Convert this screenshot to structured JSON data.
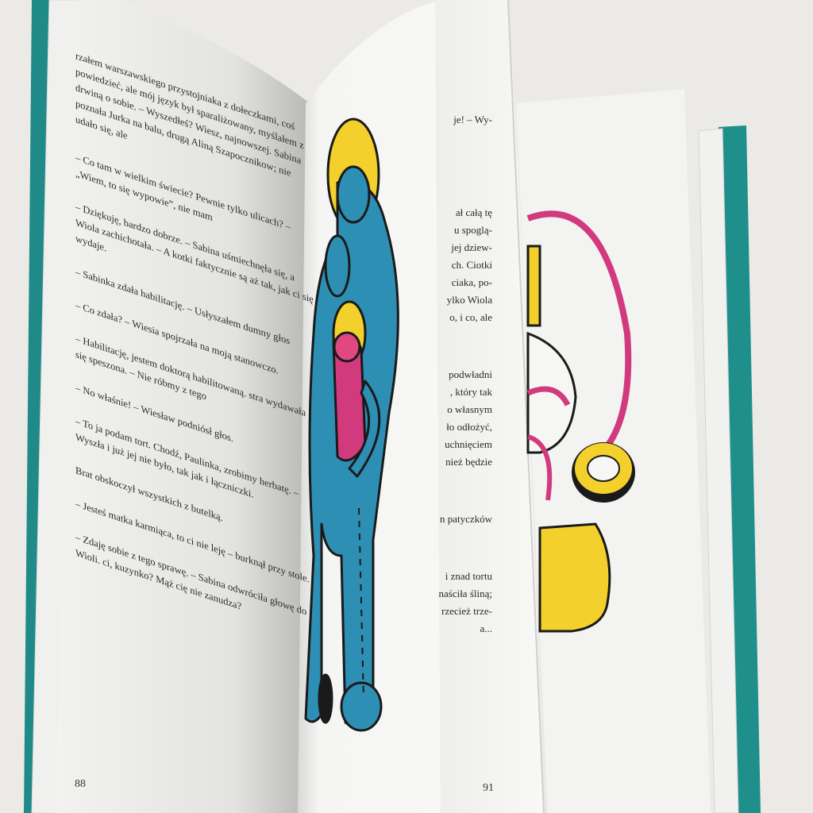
{
  "photo": {
    "description_tags": [
      "open-book",
      "illustration",
      "polish-text"
    ]
  },
  "left_page": {
    "page_number": "88",
    "paragraphs": [
      "rzałem warszawskiego przystojniaka z dołeczkami, coś powiedzieć, ale mój język był sparaliżowany, myślałem z drwiną o sobie. – Wyszedłeś? Wiesz, najnowszej. Sabina poznała Jurka na balu, drugą Aliną Szapocznikow; nie udało się, ale",
      "– Co tam w wielkim świecie? Pewnie tylko ulicach? – „Wiem, to się wypowie”, nie mam",
      "– Dziękuję, bardzo dobrze. – Sabina uśmiechnęła się, a Wiola zachichotała. – A kotki faktycznie są aż tak, jak ci się wydaje.",
      "– Sabinka zdała habilitację. – Usłyszałem dumny głos",
      "– Co zdała? – Wiesia spojrzała na moją stanowczo.",
      "– Habilitację, jestem doktorą habilitowaną. stra wydawała się speszona. – Nie róbmy z tego",
      "– No właśnie! – Wiesław podniósł głos.",
      "– To ja podam tort. Chodź, Paulinka, zrobimy herbatę. – Wyszła i już jej nie było, tak jak i łączniczki.",
      "Brat obskoczył wszystkich z butelką.",
      "– Jesteś matka karmiąca, to ci nie leję – burknął przy stole.",
      "– Zdaję sobie z tego sprawę. – Sabina odwróciła głowę do Wioli. ci, kuzynko? Mąż cię nie zanudza?"
    ]
  },
  "right_page": {
    "page_number": "91",
    "fragments": [
      "je! – Wy-",
      "ał całą tę",
      "u spoglą-",
      "jej dziew-",
      "ch. Ciotki",
      "ciaka, po-",
      "ylko Wiola",
      "o, i co, ale",
      "podwładni",
      ", który tak",
      "o własnym",
      "ło odłożyć,",
      "uchnięciem",
      "nież będzie",
      "n patyczków",
      "i znad tortu",
      "naściła śliną;",
      "rzecież trze-",
      "a..."
    ]
  },
  "colors": {
    "cover": "#1f8f8c",
    "figure_blue": "#2d8fb3",
    "halo_yellow": "#f3d02c",
    "magenta": "#d23a7e",
    "ink": "#1a1a1a",
    "paper": "#f4f4f2"
  }
}
